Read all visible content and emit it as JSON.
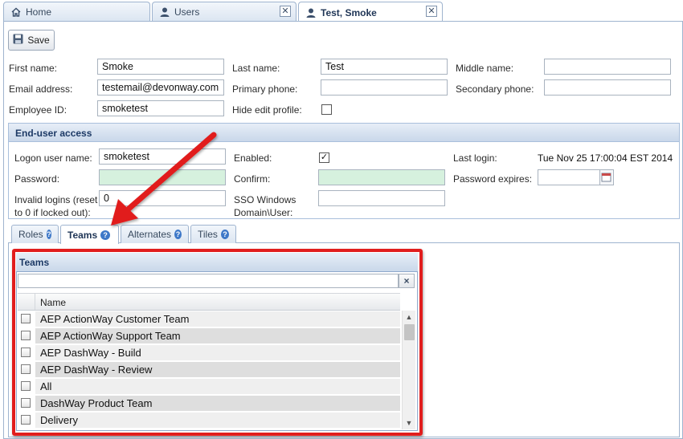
{
  "top_tabs": [
    {
      "label": "Home",
      "icon": "home-icon",
      "active": false
    },
    {
      "label": "Users",
      "icon": "user-icon",
      "active": false,
      "closable": true
    },
    {
      "label": "Test, Smoke",
      "icon": "user-icon",
      "active": true,
      "closable": true
    }
  ],
  "toolbar": {
    "save_label": "Save"
  },
  "form": {
    "first_name_label": "First name:",
    "first_name_value": "Smoke",
    "last_name_label": "Last name:",
    "last_name_value": "Test",
    "middle_name_label": "Middle name:",
    "middle_name_value": "",
    "email_label": "Email address:",
    "email_value": "testemail@devonway.com",
    "primary_phone_label": "Primary phone:",
    "primary_phone_value": "",
    "secondary_phone_label": "Secondary phone:",
    "secondary_phone_value": "",
    "employee_id_label": "Employee ID:",
    "employee_id_value": "smoketest",
    "hide_edit_profile_label": "Hide edit profile:",
    "hide_edit_profile_checked": false
  },
  "access": {
    "title": "End-user access",
    "logon_label": "Logon user name:",
    "logon_value": "smoketest",
    "enabled_label": "Enabled:",
    "enabled_checked": true,
    "last_login_label": "Last login:",
    "last_login_value": "Tue Nov 25 17:00:04 EST 2014",
    "password_label": "Password:",
    "password_value": "",
    "confirm_label": "Confirm:",
    "confirm_value": "",
    "password_expires_label": "Password expires:",
    "password_expires_value": "",
    "invalid_logins_label_1": "Invalid logins (reset",
    "invalid_logins_label_2": "to 0 if locked out):",
    "invalid_logins_value": "0",
    "sso_label_1": "SSO Windows",
    "sso_label_2": "Domain\\User:",
    "sso_value": ""
  },
  "sub_tabs": [
    {
      "label": "Roles",
      "active": false
    },
    {
      "label": "Teams",
      "active": true
    },
    {
      "label": "Alternates",
      "active": false
    },
    {
      "label": "Tiles",
      "active": false
    }
  ],
  "teams": {
    "title": "Teams",
    "filter_value": "",
    "clear_label": "×",
    "column_name": "Name",
    "rows": [
      {
        "name": "AEP ActionWay Customer Team",
        "checked": false
      },
      {
        "name": "AEP ActionWay Support Team",
        "checked": false
      },
      {
        "name": "AEP DashWay - Build",
        "checked": false
      },
      {
        "name": "AEP DashWay - Review",
        "checked": false
      },
      {
        "name": "All",
        "checked": false
      },
      {
        "name": "DashWay Product Team",
        "checked": false
      },
      {
        "name": "Delivery",
        "checked": false
      }
    ]
  },
  "colors": {
    "accent": "#1d3a66",
    "highlight_red": "#e11d1d",
    "password_bg": "#d6f1de"
  }
}
